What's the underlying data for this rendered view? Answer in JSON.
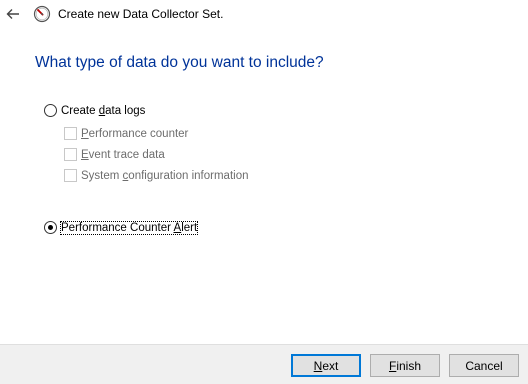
{
  "window": {
    "title": "Create new Data Collector Set."
  },
  "page": {
    "heading": "What type of data do you want to include?"
  },
  "options": {
    "create_data_logs": {
      "pre": "Create ",
      "accel": "d",
      "post": "ata logs",
      "selected": false
    },
    "checkboxes": [
      {
        "pre": "",
        "accel": "P",
        "post": "erformance counter",
        "checked": false,
        "enabled": false
      },
      {
        "pre": "",
        "accel": "E",
        "post": "vent trace data",
        "checked": false,
        "enabled": false
      },
      {
        "pre": "System ",
        "accel": "c",
        "post": "onfiguration information",
        "checked": false,
        "enabled": false
      }
    ],
    "performance_counter_alert": {
      "pre": "Performance Counter ",
      "accel": "A",
      "post": "lert",
      "selected": true
    }
  },
  "footer": {
    "next": {
      "accel": "N",
      "post": "ext"
    },
    "finish": {
      "accel": "F",
      "post": "inish"
    },
    "cancel": "Cancel"
  }
}
